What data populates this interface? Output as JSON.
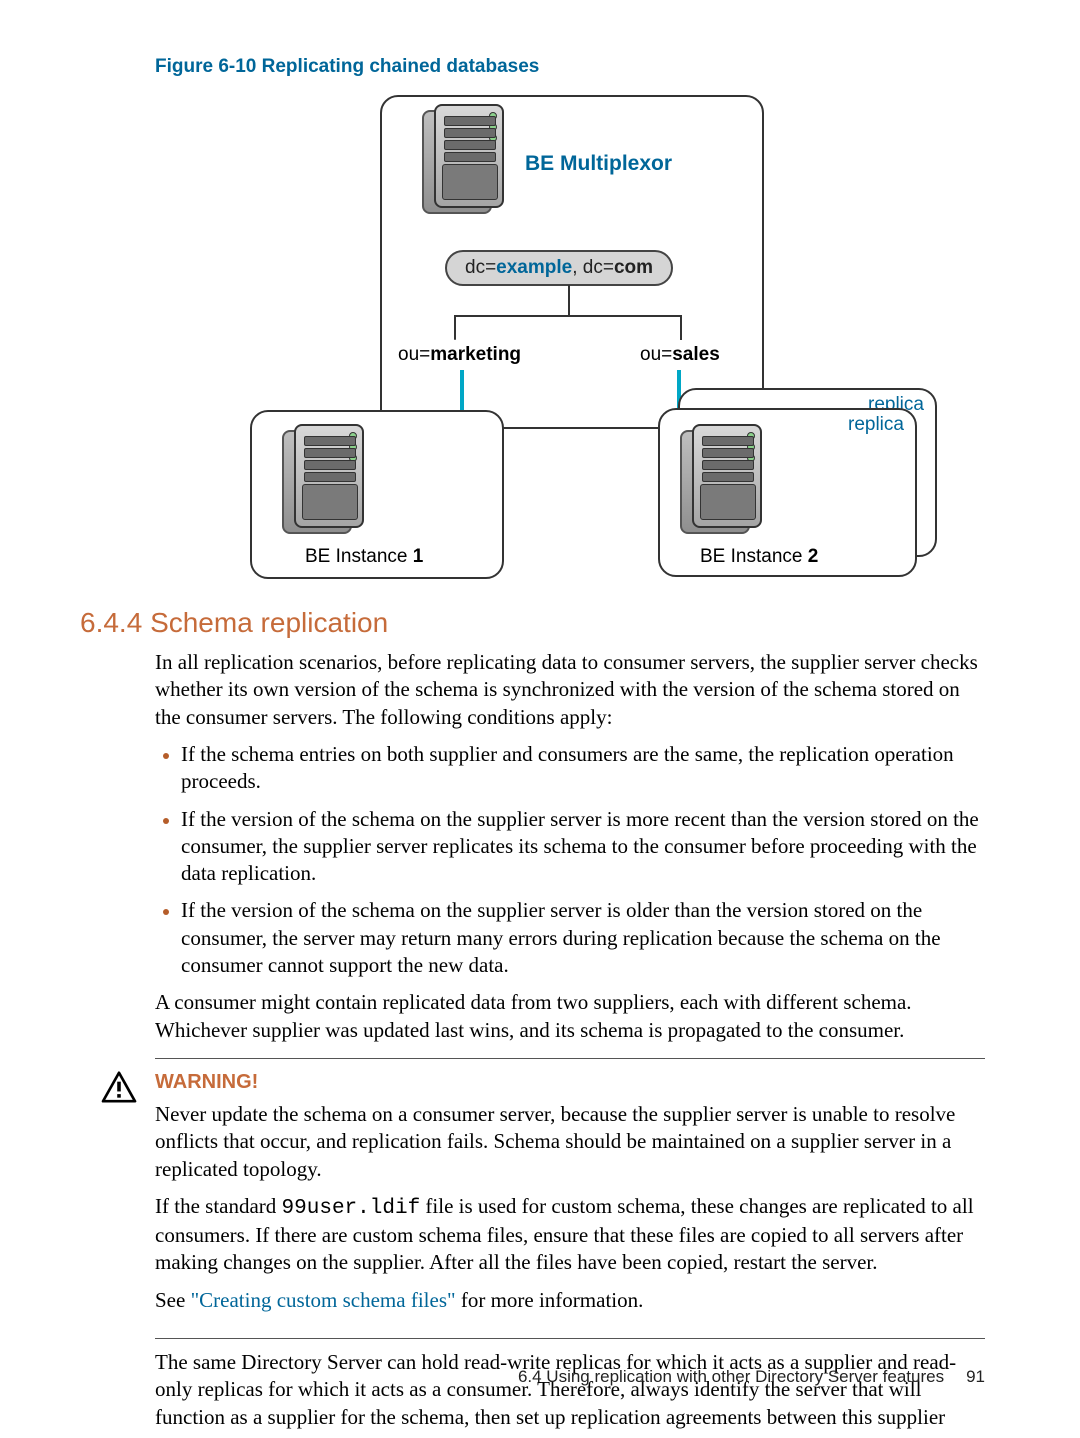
{
  "figure": {
    "caption": "Figure 6-10 Replicating chained databases",
    "multiplexor_label": "BE Multiplexor",
    "root_dn_prefix1": "dc=",
    "root_dn_bold1": "example",
    "root_dn_mid": ", dc=",
    "root_dn_bold2": "com",
    "ou_prefix": "ou=",
    "ou_left": "marketing",
    "ou_right": "sales",
    "be1_prefix": "BE Instance ",
    "be1_num": "1",
    "be2_prefix": "BE Instance ",
    "be2_num": "2",
    "replica": "replica"
  },
  "section": {
    "number": "6.4.4",
    "title": "Schema replication",
    "intro": "In all replication scenarios, before replicating data to consumer servers, the supplier server checks whether its own version of the schema is synchronized with the version of the schema stored on the consumer servers. The following conditions apply:",
    "bullets": [
      "If the schema entries on both supplier and consumers are the same, the replication operation proceeds.",
      "If the version of the schema on the supplier server is more recent than the version stored on the consumer, the supplier server replicates its schema to the consumer before proceeding with the data replication.",
      "If the version of the schema on the supplier server is older than the version stored on the consumer, the server may return many errors during replication because the schema on the consumer cannot support the new data."
    ],
    "after_bullets": "A consumer might contain replicated data from two suppliers, each with different schema. Whichever supplier was updated last wins, and its schema is propagated to the consumer."
  },
  "warning": {
    "heading": "WARNING!",
    "p1": "Never update the schema on a consumer server, because the supplier server is unable to resolve onflicts that occur, and replication fails. Schema should be maintained on a supplier server in a replicated topology.",
    "p2a": "If the standard ",
    "p2_code": "99user.ldif",
    "p2b": " file is used for custom schema, these changes are replicated to all consumers. If there are custom schema files, ensure that these files are copied to all servers after making changes on the supplier. After all the files have been copied, restart the server.",
    "p3a": "See ",
    "p3_link": "\"Creating custom schema files\"",
    "p3b": " for more information."
  },
  "after_warning": "The same Directory Server can hold read-write replicas for which it acts as a supplier and read-only replicas for which it acts as a consumer. Therefore, always identify the server that will function as a supplier for the schema, then set up replication agreements between this supplier",
  "footer": {
    "text": "6.4 Using replication with other Directory Server features",
    "page": "91"
  }
}
